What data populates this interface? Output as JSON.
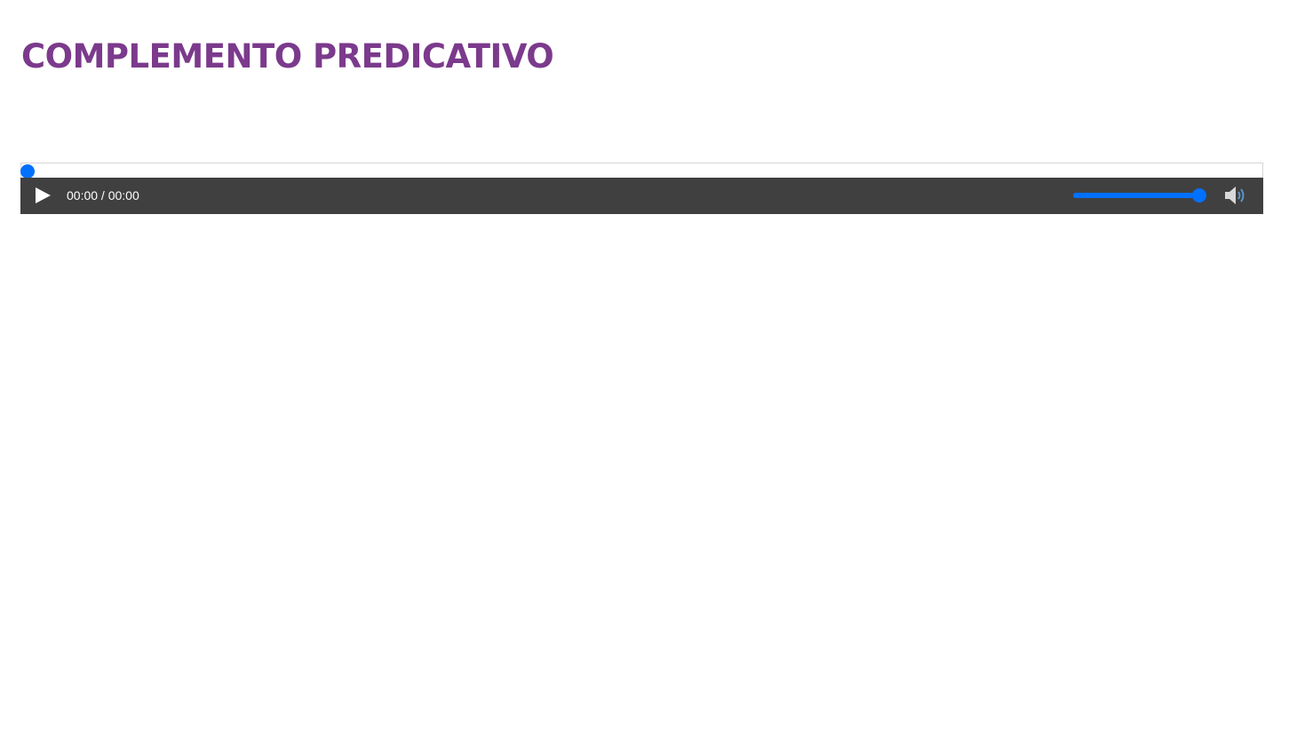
{
  "page": {
    "title": "COMPLEMENTO PREDICATIVO",
    "title_color": "#7b3a8c"
  },
  "player": {
    "time_display": "00:00 / 00:00",
    "progress_fraction": 0,
    "volume_fraction": 1,
    "accent_color": "#0070ff",
    "bar_color": "#404040",
    "icons": {
      "play": "play-icon",
      "volume": "speaker-volume-icon"
    }
  }
}
